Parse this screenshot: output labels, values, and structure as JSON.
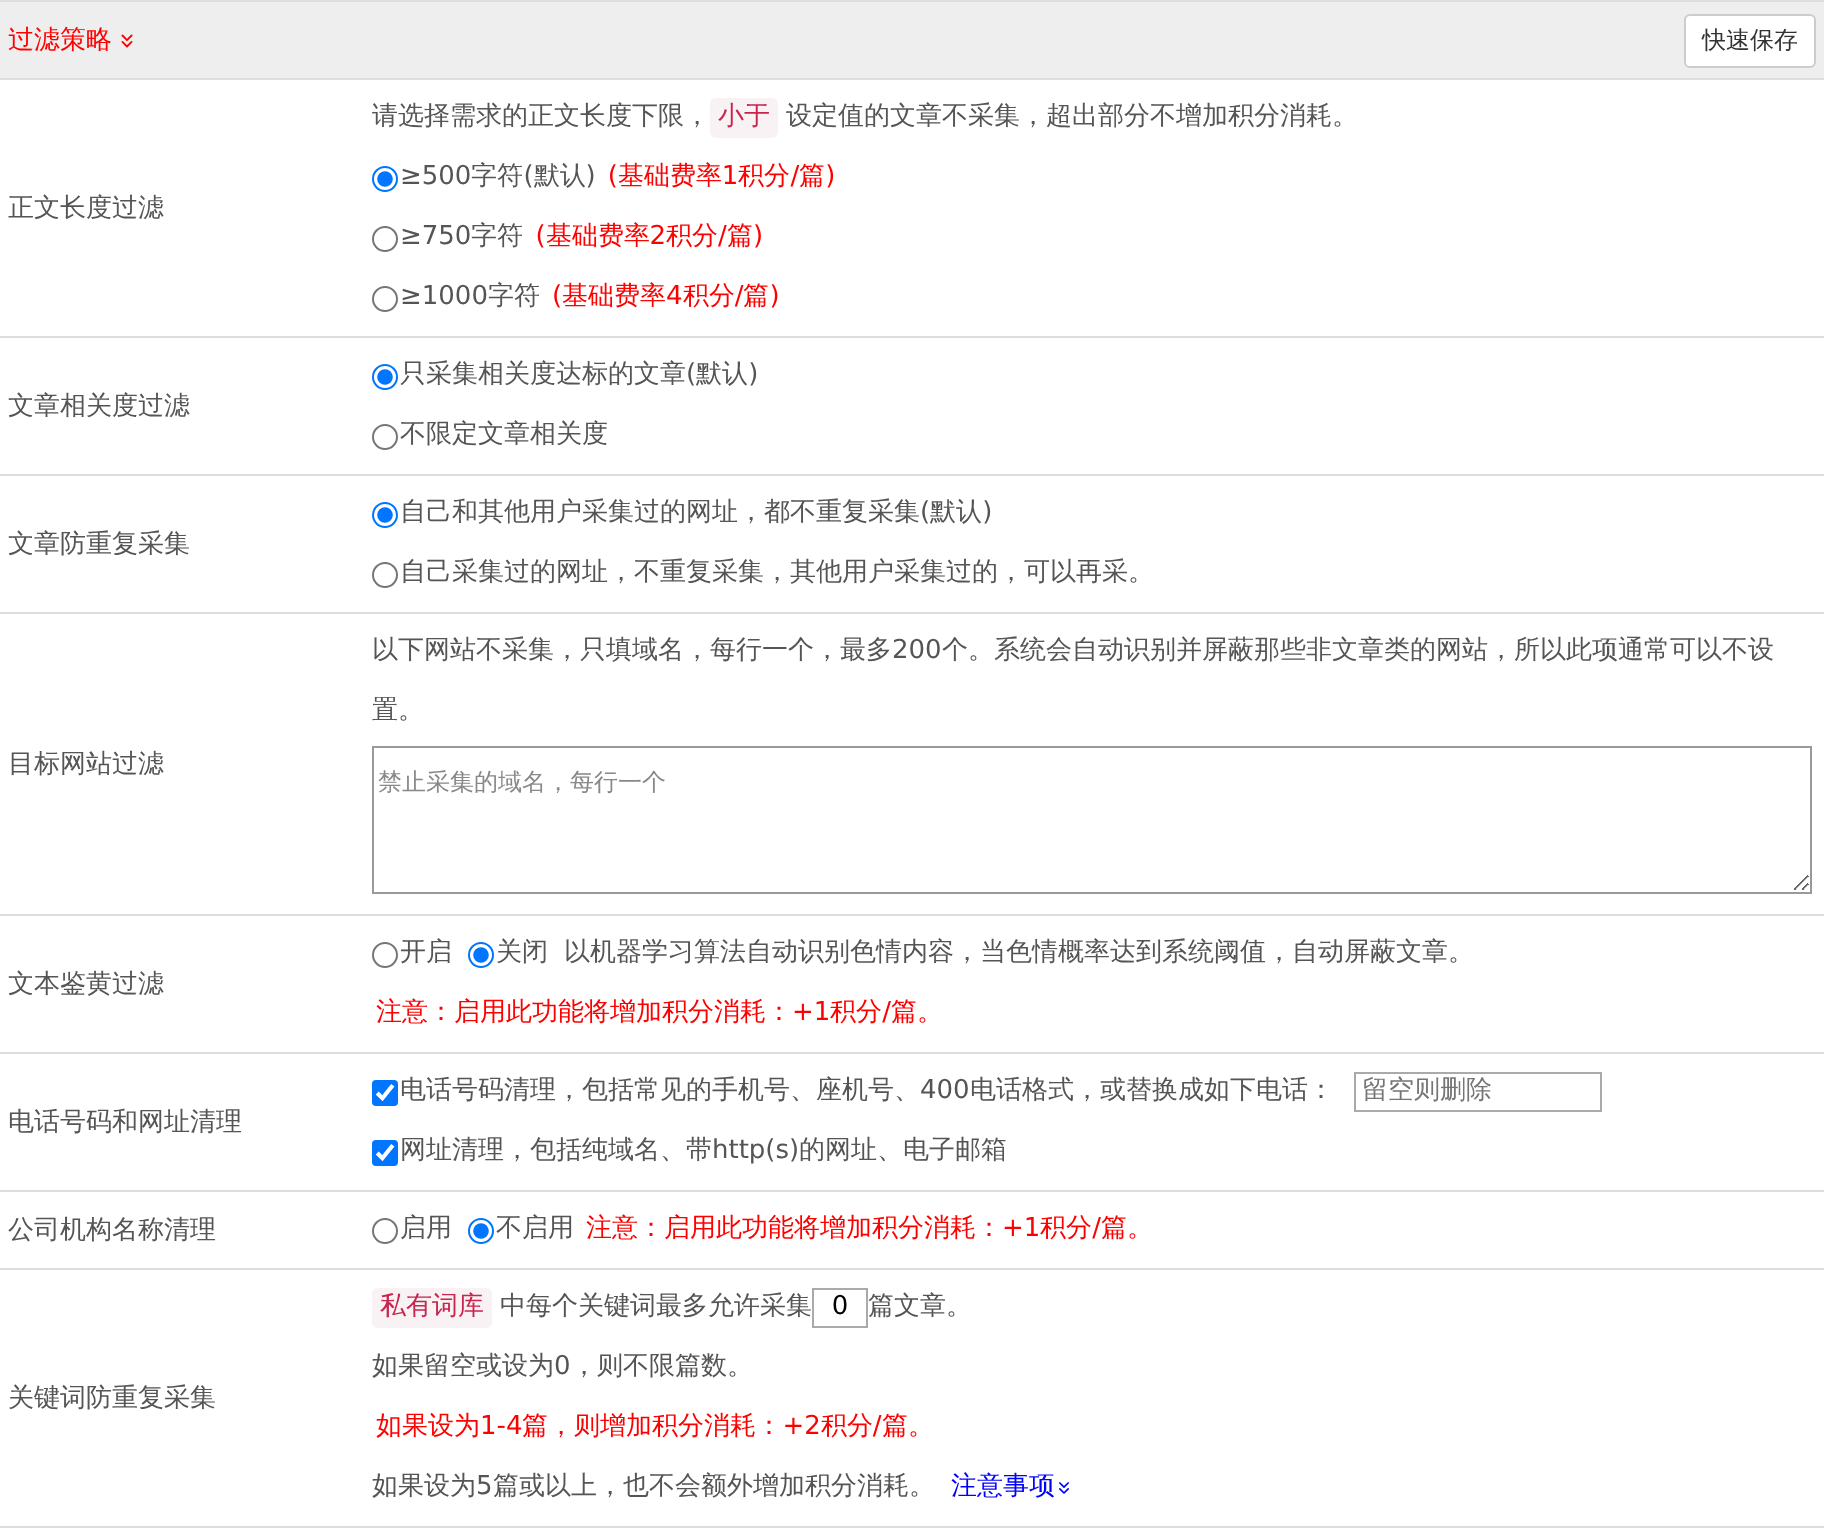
{
  "header": {
    "title": "过滤策略",
    "button": "快速保存"
  },
  "rows": [
    {
      "label": "正文长度过滤",
      "lines": [
        [
          {
            "kind": "text",
            "text": "请选择需求的正文长度下限，"
          },
          {
            "kind": "tag",
            "text": "小于"
          },
          {
            "kind": "text",
            "text": "设定值的文章不采集，超出部分不增加积分消耗。"
          }
        ],
        [
          {
            "kind": "radio",
            "text": "≥500字符(默认)",
            "selected": true
          },
          {
            "kind": "note",
            "text": "(基础费率1积分/篇)"
          }
        ],
        [
          {
            "kind": "radio",
            "text": "≥750字符",
            "selected": false
          },
          {
            "kind": "note",
            "text": "(基础费率2积分/篇)"
          }
        ],
        [
          {
            "kind": "radio",
            "text": "≥1000字符",
            "selected": false
          },
          {
            "kind": "note",
            "text": "(基础费率4积分/篇)"
          }
        ]
      ]
    },
    {
      "label": "文章相关度过滤",
      "lines": [
        [
          {
            "kind": "radio",
            "text": "只采集相关度达标的文章(默认)",
            "selected": true
          }
        ],
        [
          {
            "kind": "radio",
            "text": "不限定文章相关度",
            "selected": false
          }
        ]
      ]
    },
    {
      "label": "文章防重复采集",
      "lines": [
        [
          {
            "kind": "radio",
            "text": "自己和其他用户采集过的网址，都不重复采集(默认)",
            "selected": true
          }
        ],
        [
          {
            "kind": "radio",
            "text": "自己采集过的网址，不重复采集，其他用户采集过的，可以再采。",
            "selected": false
          }
        ]
      ]
    },
    {
      "label": "目标网站过滤",
      "lines": [
        [
          {
            "kind": "text",
            "text": "以下网站不采集，只填域名，每行一个，最多200个。系统会自动识别并屏蔽那些非文章类的网站，所以此项通常可以不设置。"
          }
        ],
        [
          {
            "kind": "textarea",
            "placeholder": "禁止采集的域名，每行一个"
          }
        ]
      ]
    },
    {
      "label": "文本鉴黄过滤",
      "lines": [
        [
          {
            "kind": "radio",
            "text": "开启",
            "selected": false
          },
          {
            "kind": "radio",
            "text": "关闭",
            "selected": true
          },
          {
            "kind": "text",
            "text": "以机器学习算法自动识别色情内容，当色情概率达到系统阈值，自动屏蔽文章。"
          }
        ],
        [
          {
            "kind": "note",
            "text": "注意：启用此功能将增加积分消耗：+1积分/篇。"
          }
        ]
      ]
    },
    {
      "label": "电话号码和网址清理",
      "lines": [
        [
          {
            "kind": "check",
            "text": "电话号码清理，包括常见的手机号、座机号、400电话格式，或替换成如下电话：",
            "checked": true
          },
          {
            "kind": "input",
            "placeholder": "留空则删除"
          }
        ],
        [
          {
            "kind": "check",
            "text": "网址清理，包括纯域名、带http(s)的网址、电子邮箱",
            "checked": true
          }
        ]
      ]
    },
    {
      "label": "公司机构名称清理",
      "lines": [
        [
          {
            "kind": "radio",
            "text": "启用",
            "selected": false
          },
          {
            "kind": "radio",
            "text": "不启用",
            "selected": true
          },
          {
            "kind": "note",
            "text": "注意：启用此功能将增加积分消耗：+1积分/篇。"
          }
        ]
      ]
    },
    {
      "label": "关键词防重复采集",
      "lines": [
        [
          {
            "kind": "tag",
            "text": "私有词库"
          },
          {
            "kind": "text",
            "text": "中每个关键词最多允许采集"
          },
          {
            "kind": "number",
            "value": "0"
          },
          {
            "kind": "text",
            "text": "篇文章。"
          }
        ],
        [
          {
            "kind": "text",
            "text": "如果留空或设为0，则不限篇数。"
          }
        ],
        [
          {
            "kind": "note",
            "text": "如果设为1-4篇，则增加积分消耗：+2积分/篇。"
          }
        ],
        [
          {
            "kind": "text",
            "text": "如果设为5篇或以上，也不会额外增加积分消耗。"
          },
          {
            "kind": "link",
            "text": "注意事项"
          }
        ]
      ]
    }
  ]
}
